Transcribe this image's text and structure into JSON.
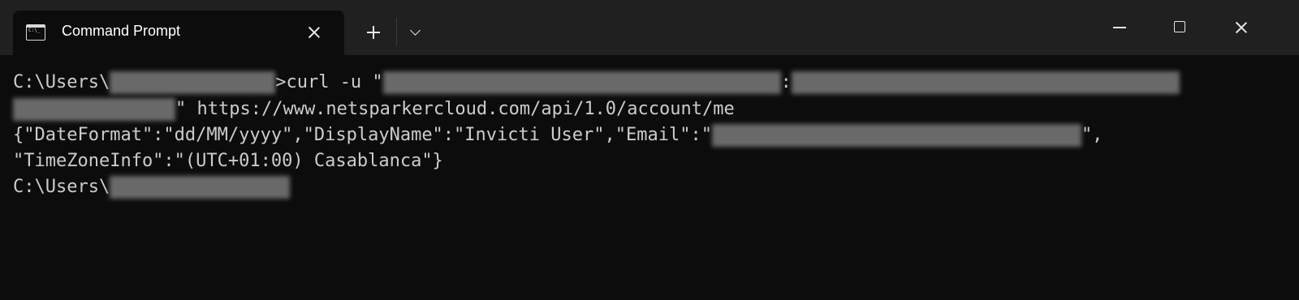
{
  "window": {
    "tab": {
      "icon": "terminal-icon",
      "title": "Command Prompt",
      "close_icon": "close-icon"
    },
    "new_tab_icon": "plus-icon",
    "dropdown_icon": "chevron-down-icon",
    "controls": {
      "minimize_icon": "minimize-icon",
      "maximize_icon": "maximize-icon",
      "close_icon": "close-icon"
    }
  },
  "terminal": {
    "colors": {
      "background": "#0c0c0c",
      "foreground": "#cccccc",
      "titlebar": "#202020"
    },
    "lines": [
      {
        "prompt": "C:\\Users\\",
        "prompt_suffix": ">curl -u \"",
        "credential_separator": ":"
      },
      {
        "text": "\" https://www.netsparkercloud.com/api/1.0/account/me"
      },
      {
        "text": "{\"DateFormat\":\"dd/MM/yyyy\",\"DisplayName\":\"Invicti User\",\"Email\":\"",
        "suffix": "\","
      },
      {
        "text": "\"TimeZoneInfo\":\"(UTC+01:00) Casablanca\"}"
      },
      {
        "prompt": "C:\\Users\\"
      }
    ]
  }
}
